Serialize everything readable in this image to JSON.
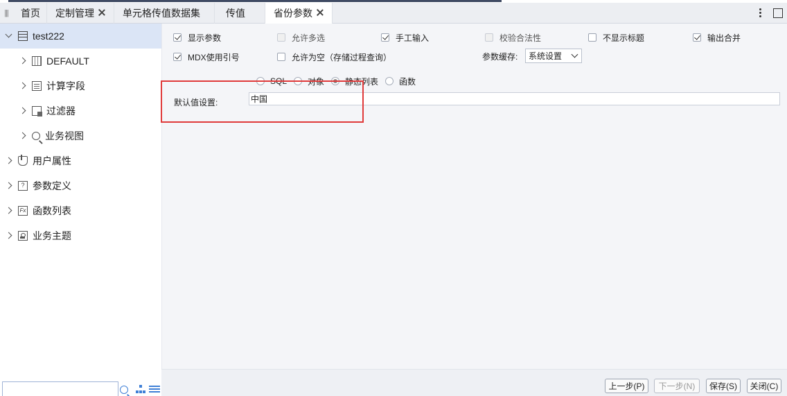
{
  "tabs": [
    {
      "label": "首页",
      "closable": false,
      "active": false
    },
    {
      "label": "定制管理",
      "closable": true,
      "active": false
    },
    {
      "label": "单元格传值数据集",
      "closable": false,
      "active": false
    },
    {
      "label": "传值",
      "closable": false,
      "active": false
    },
    {
      "label": "省份参数",
      "closable": true,
      "active": true
    }
  ],
  "sidebar": {
    "root": {
      "label": "test222",
      "icon": "database-icon",
      "expanded": true
    },
    "children": [
      {
        "label": "DEFAULT",
        "icon": "grid-icon"
      },
      {
        "label": "计算字段",
        "icon": "document-icon"
      },
      {
        "label": "过滤器",
        "icon": "filter-icon"
      },
      {
        "label": "业务视图",
        "icon": "search-icon"
      }
    ],
    "top_items": [
      {
        "label": "用户属性",
        "icon": "hand-icon"
      },
      {
        "label": "参数定义",
        "icon": "question-doc-icon"
      },
      {
        "label": "函数列表",
        "icon": "function-icon"
      },
      {
        "label": "业务主题",
        "icon": "theme-icon"
      }
    ],
    "search_placeholder": ""
  },
  "options": {
    "show_param": {
      "label": "显示参数",
      "checked": true
    },
    "allow_multi": {
      "label": "允许多选",
      "checked": false,
      "disabled": true
    },
    "manual_input": {
      "label": "手工输入",
      "checked": true
    },
    "validate": {
      "label": "校验合法性",
      "checked": false,
      "disabled": true
    },
    "hide_title": {
      "label": "不显示标题",
      "checked": false
    },
    "output_merge": {
      "label": "输出合并",
      "checked": true
    },
    "mdx_quote": {
      "label": "MDX使用引号",
      "checked": true
    },
    "allow_empty": {
      "label": "允许为空（存储过程查询）",
      "checked": false
    }
  },
  "param_cache": {
    "label": "参数缓存:",
    "value": "系统设置"
  },
  "source_types": [
    {
      "label": "SQL",
      "selected": false
    },
    {
      "label": "对象",
      "selected": false
    },
    {
      "label": "静态列表",
      "selected": true
    },
    {
      "label": "函数",
      "selected": false
    }
  ],
  "default_value": {
    "label": "默认值设置:",
    "value": "中国"
  },
  "buttons": {
    "prev": "上一步(P)",
    "next": "下一步(N)",
    "save": "保存(S)",
    "close": "关闭(C)"
  },
  "colors": {
    "highlight": "#e03a3a",
    "selected_row": "#dbe5f6",
    "accent": "#3e7fd6"
  }
}
